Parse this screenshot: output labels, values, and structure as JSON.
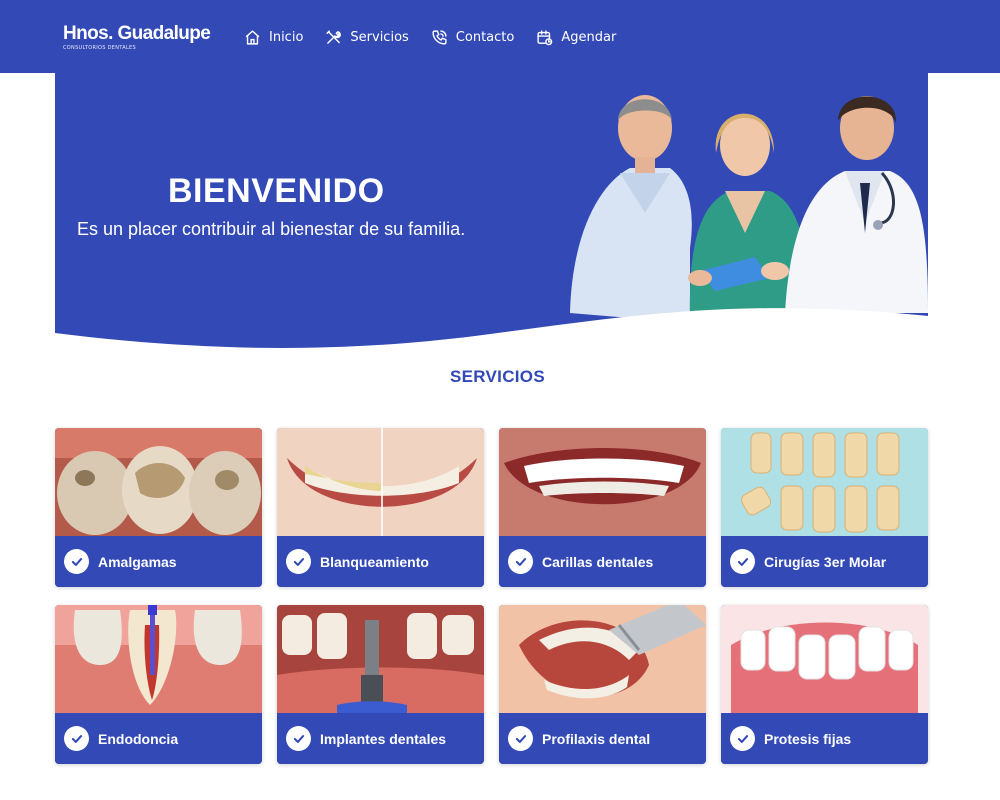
{
  "brand": {
    "name": "Hnos. Guadalupe",
    "tagline": "CONSULTORIOS DENTALES"
  },
  "nav": [
    {
      "label": "Inicio",
      "icon": "home-icon"
    },
    {
      "label": "Servicios",
      "icon": "tools-icon"
    },
    {
      "label": "Contacto",
      "icon": "phone-icon"
    },
    {
      "label": "Agendar",
      "icon": "calendar-icon"
    }
  ],
  "hero": {
    "title": "BIENVENIDO",
    "subtitle": "Es un placer contribuir al bienestar de su familia."
  },
  "services": {
    "title": "SERVICIOS",
    "items": [
      {
        "label": "Amalgamas",
        "image": "amalgam-fillings-photo"
      },
      {
        "label": "Blanqueamiento",
        "image": "teeth-whitening-photo"
      },
      {
        "label": "Carillas dentales",
        "image": "dental-veneers-photo"
      },
      {
        "label": "Cirugías 3er Molar",
        "image": "third-molar-surgery-photo"
      },
      {
        "label": "Endodoncia",
        "image": "root-canal-photo"
      },
      {
        "label": "Implantes dentales",
        "image": "dental-implant-photo"
      },
      {
        "label": "Profilaxis dental",
        "image": "dental-cleaning-photo"
      },
      {
        "label": "Protesis fijas",
        "image": "fixed-prosthesis-photo"
      }
    ]
  },
  "colors": {
    "primary": "#3249b6",
    "white": "#ffffff"
  }
}
